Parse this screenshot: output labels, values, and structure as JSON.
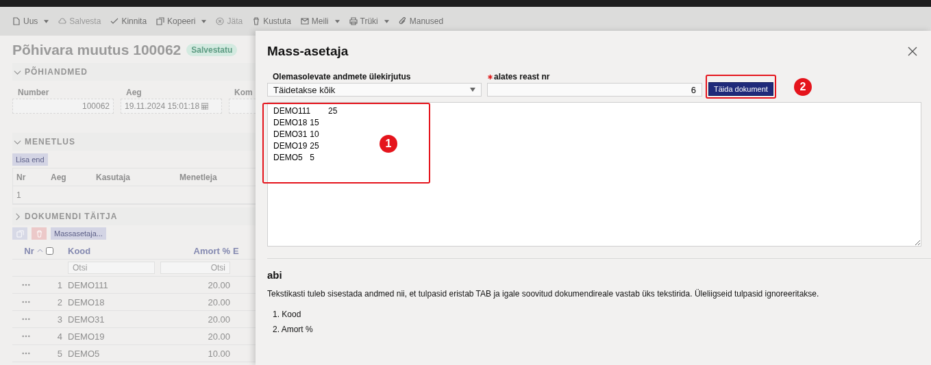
{
  "toolbar": [
    {
      "label": "Uus",
      "disabled": false,
      "dropdown": true
    },
    {
      "label": "Salvesta",
      "disabled": true,
      "dropdown": false
    },
    {
      "label": "Kinnita",
      "disabled": false,
      "dropdown": false
    },
    {
      "label": "Kopeeri",
      "disabled": false,
      "dropdown": true
    },
    {
      "label": "Jäta",
      "disabled": true,
      "dropdown": false
    },
    {
      "label": "Kustuta",
      "disabled": false,
      "dropdown": false
    },
    {
      "label": "Meili",
      "disabled": false,
      "dropdown": true
    },
    {
      "label": "Trüki",
      "disabled": false,
      "dropdown": true
    },
    {
      "label": "Manused",
      "disabled": false,
      "dropdown": false
    }
  ],
  "document": {
    "title": "Põhivara muutus 100062",
    "status": "Salvestatu",
    "main_section": {
      "title": "PÕHIANDMED",
      "expanded": true,
      "fields": [
        {
          "label": "Number",
          "value": "100062"
        },
        {
          "label": "Aeg",
          "value": "19.11.2024 15:01:18"
        },
        {
          "label": "Kom"
        }
      ]
    },
    "procedure_section": {
      "title": "MENETLUS",
      "expanded": true,
      "button": "Lisa end",
      "columns": [
        "Nr",
        "Aeg",
        "Kasutaja",
        "Menetleja"
      ],
      "rows": [
        [
          "1"
        ]
      ]
    },
    "filler_section": {
      "title": "DOKUMENDI TÄITJA",
      "expanded": false,
      "button": "Massasetaja...",
      "columns": [
        "Nr",
        "Kood",
        "Amort %",
        "E"
      ],
      "select_all_checked": false,
      "filters": [
        {
          "placeholder": "Otsi"
        },
        {
          "placeholder": "Otsi"
        }
      ],
      "rows": [
        {
          "nr": "1",
          "kood": "DEMO111",
          "amort": "20.00"
        },
        {
          "nr": "2",
          "kood": "DEMO18",
          "amort": "20.00"
        },
        {
          "nr": "3",
          "kood": "DEMO31",
          "amort": "20.00"
        },
        {
          "nr": "4",
          "kood": "DEMO19",
          "amort": "20.00"
        },
        {
          "nr": "5",
          "kood": "DEMO5",
          "amort": "10.00"
        }
      ]
    }
  },
  "dialog": {
    "title": "Mass-asetaja",
    "overwrite": {
      "label": "Olemasolevate andmete ülekirjutus",
      "value": "Täidetakse kõik"
    },
    "start_row": {
      "label": "alates reast nr",
      "required": true,
      "value": "6"
    },
    "button": "Täida dokument",
    "paste_text": "DEMO111\t25\nDEMO18\t15\nDEMO31\t10\nDEMO19\t25\nDEMO5\t5",
    "help": {
      "title": "abi",
      "text": "Tekstikasti tuleb sisestada andmed nii, et tulpasid eristab TAB ja igale soovitud dokumendireale vastab üks tekstirida. Üleliigseid tulpasid ignoreeritakse.",
      "items": [
        "1. Kood",
        "2. Amort %"
      ]
    },
    "annotations": [
      "1",
      "2"
    ]
  }
}
